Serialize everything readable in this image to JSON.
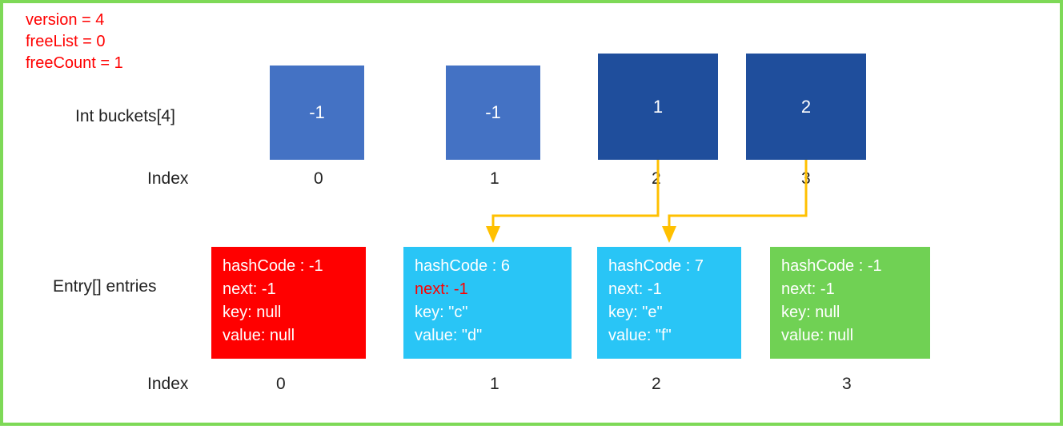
{
  "meta": {
    "version_line": "version = 4",
    "freeList_line": "freeList = 0",
    "freeCount_line": "freeCount = 1"
  },
  "labels": {
    "buckets": "Int buckets[4]",
    "index": "Index",
    "entries": "Entry[] entries"
  },
  "buckets": {
    "b0": "-1",
    "b1": "-1",
    "b2": "1",
    "b3": "2"
  },
  "bucket_indices": {
    "i0": "0",
    "i1": "1",
    "i2": "2",
    "i3": "3"
  },
  "entries": {
    "e0": {
      "hash": "hashCode : -1",
      "next": "next: -1",
      "key": "key: null",
      "value": "value: null"
    },
    "e1": {
      "hash": "hashCode : 6",
      "next": "next: -1",
      "key": "key: \"c\"",
      "value": "value: \"d\""
    },
    "e2": {
      "hash": "hashCode : 7",
      "next": -1,
      "next_line": "next: -1",
      "key": "key: \"e\"",
      "value": "value: \"f\""
    },
    "e3": {
      "hash": "hashCode : -1",
      "next": "next: -1",
      "key": "key: null",
      "value": "value: null"
    }
  },
  "entry_indices": {
    "i0": "0",
    "i1": "1",
    "i2": "2",
    "i3": "3"
  },
  "colors": {
    "border": "#7ED957",
    "meta_text": "#FF0000",
    "bucket_light": "#4472C4",
    "bucket_dark": "#1F4E9C",
    "entry_red": "#FF0000",
    "entry_blue": "#29C5F6",
    "entry_green": "#70D154",
    "arrow": "#FFC000"
  },
  "chart_data": {
    "type": "table",
    "version": 4,
    "freeList": 0,
    "freeCount": 1,
    "buckets": [
      -1,
      -1,
      1,
      2
    ],
    "entries": [
      {
        "index": 0,
        "hashCode": -1,
        "next": -1,
        "key": null,
        "value": null
      },
      {
        "index": 1,
        "hashCode": 6,
        "next": -1,
        "key": "c",
        "value": "d"
      },
      {
        "index": 2,
        "hashCode": 7,
        "next": -1,
        "key": "e",
        "value": "f"
      },
      {
        "index": 3,
        "hashCode": -1,
        "next": -1,
        "key": null,
        "value": null
      }
    ],
    "arrows": [
      {
        "from_bucket_index": 2,
        "to_entry_index": 1
      },
      {
        "from_bucket_index": 3,
        "to_entry_index": 2
      }
    ]
  }
}
